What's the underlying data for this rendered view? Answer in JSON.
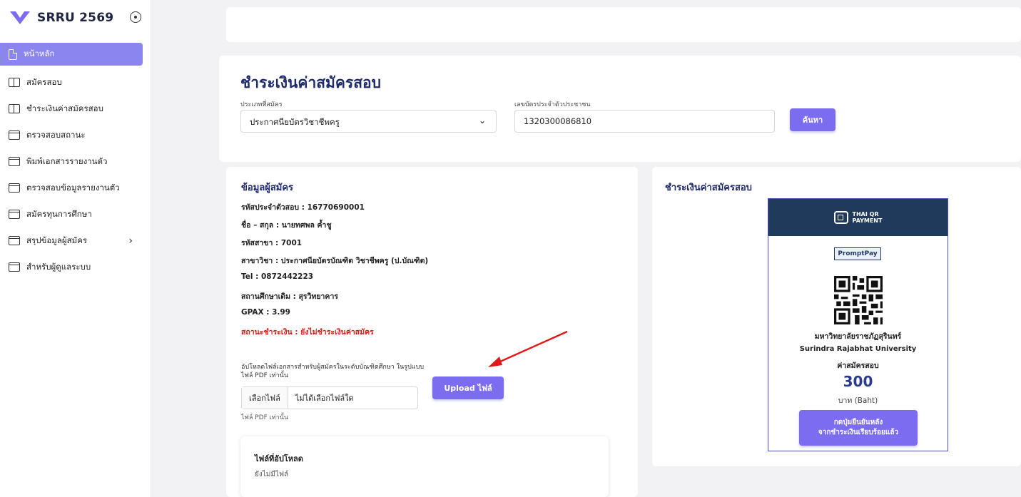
{
  "sidebar": {
    "brand": "SRRU 2569",
    "items": [
      {
        "label": "หน้าหลัก",
        "icon": "document-icon",
        "active": true
      },
      {
        "label": "สมัครสอบ",
        "icon": "book-icon"
      },
      {
        "label": "ชำระเงินค่าสมัครสอบ",
        "icon": "book-icon"
      },
      {
        "label": "ตรวจสอบสถานะ",
        "icon": "window-icon"
      },
      {
        "label": "พิมพ์เอกสารรายงานตัว",
        "icon": "window-icon"
      },
      {
        "label": "ตรวจสอบข้อมูลรายงานตัว",
        "icon": "window-icon"
      },
      {
        "label": "สมัครทุนการศึกษา",
        "icon": "window-icon"
      },
      {
        "label": "สรุปข้อมูลผู้สมัคร",
        "icon": "window-icon",
        "has_submenu": true
      },
      {
        "label": "สำหรับผู้ดูแลระบบ",
        "icon": "window-icon"
      }
    ]
  },
  "search": {
    "title": "ชำระเงินค่าสมัครสอบ",
    "type_label": "ประเภทที่สมัคร",
    "type_value": "ประกาศนียบัตรวิชาชีพครู",
    "id_label": "เลขบัตรประจำตัวประชาชน",
    "id_value": "1320300086810",
    "search_button": "ค้นหา"
  },
  "applicant": {
    "title": "ข้อมูลผู้สมัคร",
    "lines": [
      "รหัสประจำตัวสอบ : 16770690001",
      "ชื่อ – สกุล : นายทศพล ค้ำชู",
      "รหัสสาขา : 7001",
      "สาขาวิชา : ประกาศนียบัตรบัณฑิต วิชาชีพครู (ป.บัณฑิต)",
      "Tel : 0872442223",
      "สถานศึกษาเดิม : สุรวิทยาคาร",
      "GPAX : 3.99"
    ],
    "status": "สถานะชำระเงิน : ยังไม่ชำระเงินค่าสมัคร",
    "upload_desc": "อัปโหลดไฟล์เอกสารสำหรับผู้สมัครในระดับบัณฑิตศึกษา ในรูปแบบไฟล์ PDF เท่านั้น",
    "choose_file": "เลือกไฟล์",
    "no_file": "ไม่ได้เลือกไฟล์ใด",
    "upload_button": "Upload ไฟล์",
    "file_note": "ไฟล์ PDF เท่านั้น",
    "uploaded_title": "ไฟล์ที่อัปโหลด",
    "uploaded_empty": "ยังไม่มีไฟล์"
  },
  "payment": {
    "title": "ชำระเงินค่าสมัครสอบ",
    "qr_header_1": "THAI QR",
    "qr_header_2": "PAYMENT",
    "promptpay": "PromptPay",
    "university_th": "มหาวิทยาลัยราชภัฏสุรินทร์",
    "university_en": "Surindra Rajabhat University",
    "fee_label": "ค่าสมัครสอบ",
    "amount": "300",
    "currency": "บาท (Baht)",
    "confirm_line1": "กดปุ่มยืนยันหลัง",
    "confirm_line2": "จากชำระเงินเรียบร้อยแล้ว"
  },
  "colors": {
    "accent": "#7c6df0",
    "title": "#1e2a6a",
    "status_red": "#e01818",
    "qr_header": "#1f3a5a"
  }
}
